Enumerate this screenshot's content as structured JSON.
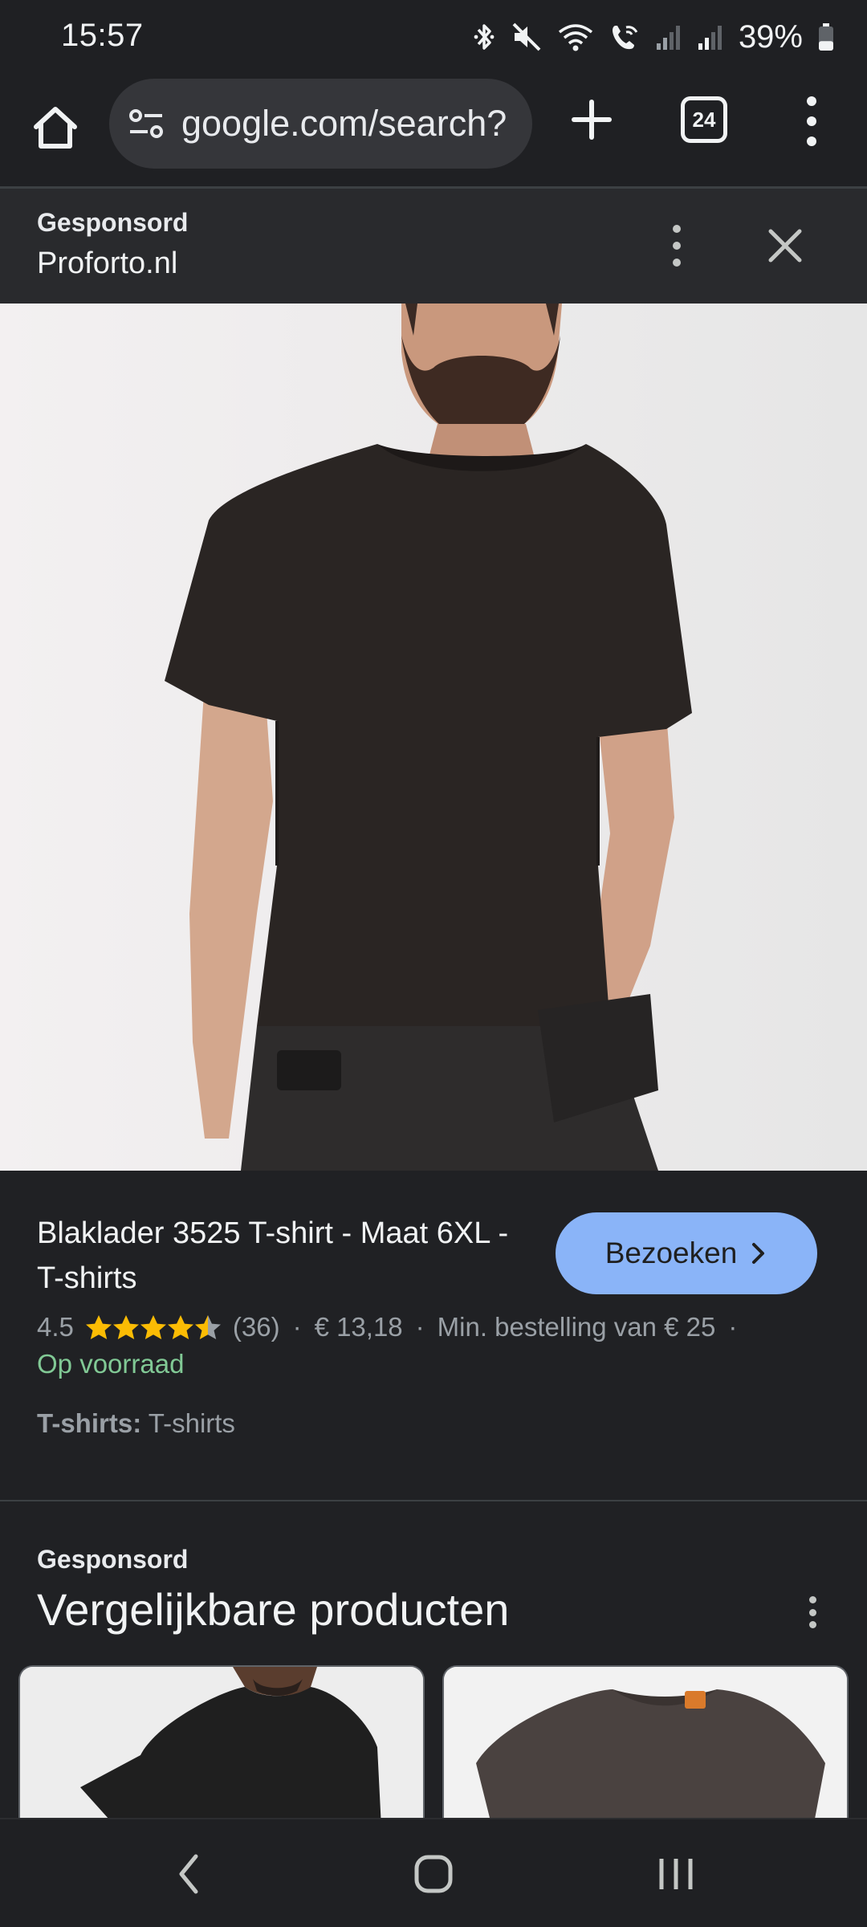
{
  "status_bar": {
    "time": "15:57",
    "battery_percent": "39%",
    "battery_level": 0.39
  },
  "browser": {
    "url": "google.com/search?",
    "tab_count": "24"
  },
  "sponsored_header": {
    "label": "Gesponsord",
    "domain": "Proforto.nl"
  },
  "product": {
    "title": "Blaklader 3525 T-shirt - Maat 6XL - T-shirts",
    "visit_label": "Bezoeken",
    "rating": "4.5",
    "rating_value": 4.5,
    "rating_max": 5,
    "review_count": "(36)",
    "price": "€ 13,18",
    "min_order": "Min. bestelling van € 25",
    "separator": "·",
    "stock": "Op voorraad",
    "category_key": "T-shirts:",
    "category_value": "T-shirts"
  },
  "similar": {
    "label": "Gesponsord",
    "title": "Vergelijkbare producten"
  },
  "colors": {
    "accent": "#8ab4f8",
    "stock_green": "#81c995",
    "star": "#fbbc04",
    "background": "#202124"
  },
  "icons": {
    "home": "home-icon",
    "site_settings": "tune-icon",
    "new_tab": "plus-icon",
    "menu": "more-vert-icon",
    "close": "close-icon",
    "back": "chevron-left-icon",
    "nav_home": "rounded-square-icon",
    "recents": "recents-icon"
  }
}
